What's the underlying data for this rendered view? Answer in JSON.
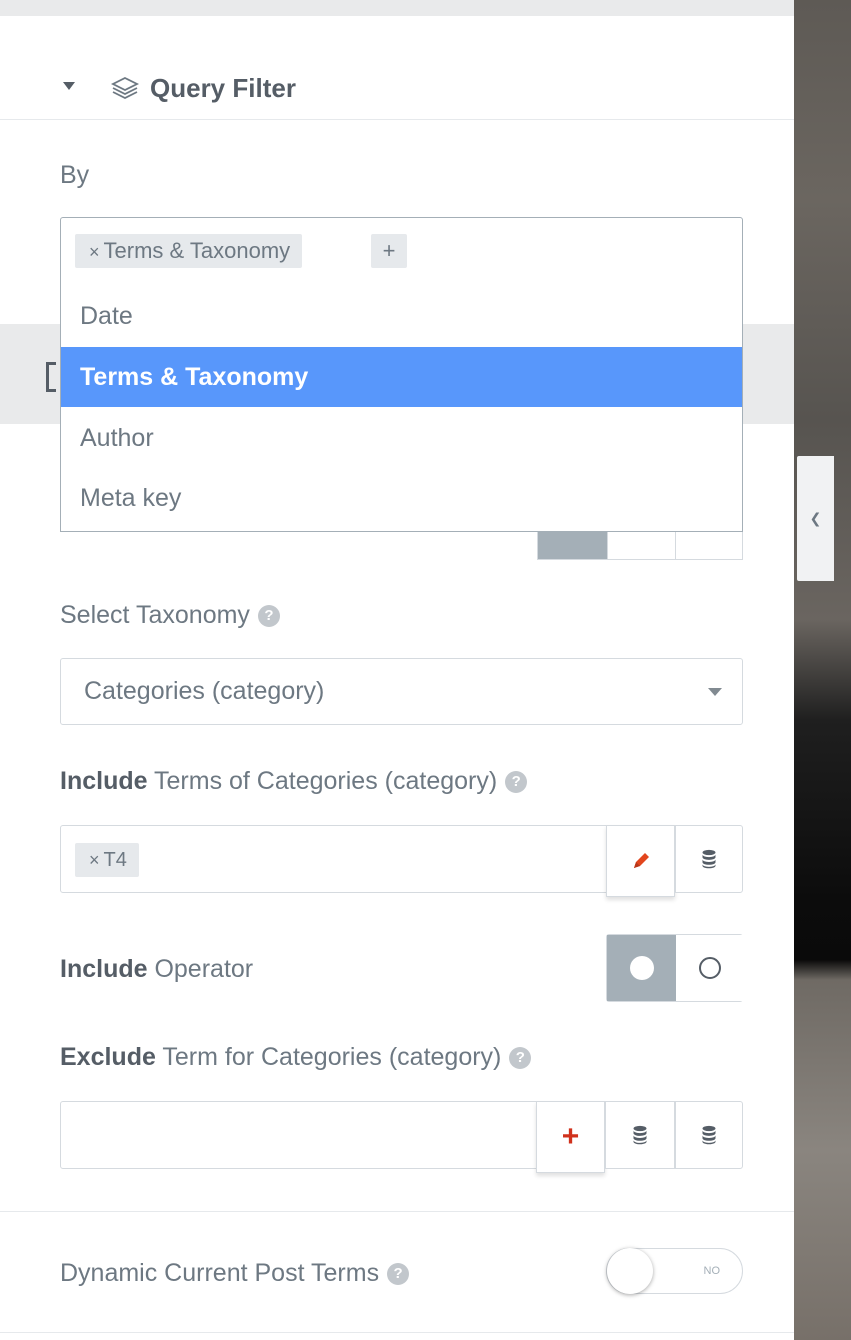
{
  "section": {
    "title": "Query Filter"
  },
  "by": {
    "label": "By",
    "selected_chip": "Terms & Taxonomy",
    "chip_remove": "×",
    "add_button": "+",
    "dropdown": [
      {
        "label": "Date",
        "highlighted": false
      },
      {
        "label": "Terms & Taxonomy",
        "highlighted": true
      },
      {
        "label": "Author",
        "highlighted": false
      },
      {
        "label": "Meta key",
        "highlighted": false
      }
    ]
  },
  "select_taxonomy": {
    "label": "Select Taxonomy",
    "value": "Categories (category)"
  },
  "include_terms": {
    "label_bold": "Include",
    "label_rest": " Terms of Categories (category)",
    "chip": "T4",
    "chip_remove": "×"
  },
  "include_operator": {
    "label_bold": "Include",
    "label_rest": " Operator"
  },
  "exclude_terms": {
    "label_bold": "Exclude",
    "label_rest": " Term for Categories (category)",
    "add_icon": "+"
  },
  "dynamic_terms": {
    "label": "Dynamic Current Post Terms",
    "switch_text": "NO"
  },
  "help_glyph": "?",
  "colors": {
    "highlight": "#5897fb",
    "pencil": "#e2451d",
    "plus": "#d0311c",
    "active_toggle": "#a4afb7"
  }
}
